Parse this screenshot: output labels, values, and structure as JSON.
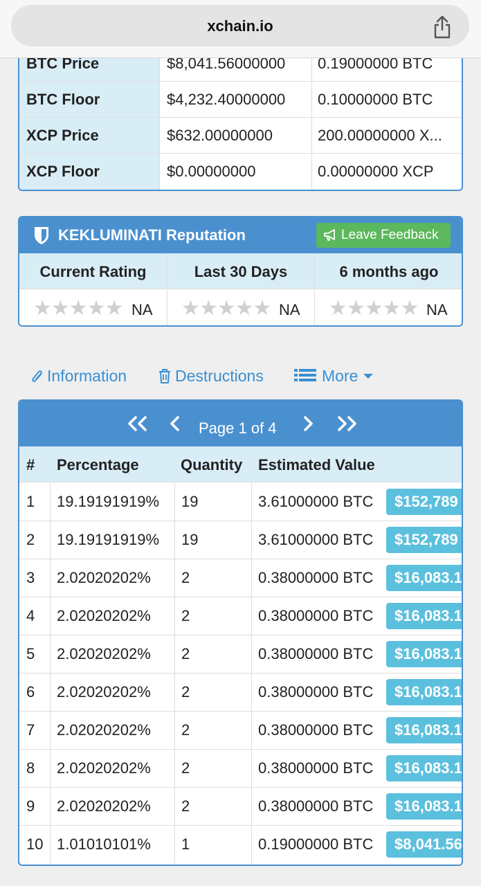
{
  "browser": {
    "url": "xchain.io"
  },
  "prices": [
    {
      "label": "BTC Price",
      "usd": "$8,041.56000000",
      "native": "0.19000000 BTC"
    },
    {
      "label": "BTC Floor",
      "usd": "$4,232.40000000",
      "native": "0.10000000 BTC"
    },
    {
      "label": "XCP Price",
      "usd": "$632.00000000",
      "native": "200.00000000 X..."
    },
    {
      "label": "XCP Floor",
      "usd": "$0.00000000",
      "native": "0.00000000 XCP"
    }
  ],
  "reputation": {
    "title": "KEKLUMINATI Reputation",
    "feedback_label": "Leave Feedback",
    "columns": [
      "Current Rating",
      "Last 30 Days",
      "6 months ago"
    ],
    "values": [
      "NA",
      "NA",
      "NA"
    ],
    "stars": "★★★★★"
  },
  "tabs": {
    "information": "Information",
    "destructions": "Destructions",
    "more": "More"
  },
  "pager": {
    "label": "Page 1 of 4"
  },
  "holders": {
    "headers": [
      "#",
      "Percentage",
      "Quantity",
      "Estimated Value"
    ],
    "rows": [
      {
        "n": "1",
        "pct": "19.19191919%",
        "qty": "19",
        "btc": "3.61000000 BTC",
        "usd": "$152,789"
      },
      {
        "n": "2",
        "pct": "19.19191919%",
        "qty": "19",
        "btc": "3.61000000 BTC",
        "usd": "$152,789"
      },
      {
        "n": "3",
        "pct": "2.02020202%",
        "qty": "2",
        "btc": "0.38000000 BTC",
        "usd": "$16,083.1"
      },
      {
        "n": "4",
        "pct": "2.02020202%",
        "qty": "2",
        "btc": "0.38000000 BTC",
        "usd": "$16,083.1"
      },
      {
        "n": "5",
        "pct": "2.02020202%",
        "qty": "2",
        "btc": "0.38000000 BTC",
        "usd": "$16,083.1"
      },
      {
        "n": "6",
        "pct": "2.02020202%",
        "qty": "2",
        "btc": "0.38000000 BTC",
        "usd": "$16,083.1"
      },
      {
        "n": "7",
        "pct": "2.02020202%",
        "qty": "2",
        "btc": "0.38000000 BTC",
        "usd": "$16,083.1"
      },
      {
        "n": "8",
        "pct": "2.02020202%",
        "qty": "2",
        "btc": "0.38000000 BTC",
        "usd": "$16,083.1"
      },
      {
        "n": "9",
        "pct": "2.02020202%",
        "qty": "2",
        "btc": "0.38000000 BTC",
        "usd": "$16,083.1"
      },
      {
        "n": "10",
        "pct": "1.01010101%",
        "qty": "1",
        "btc": "0.19000000 BTC",
        "usd": "$8,041.56"
      }
    ]
  }
}
